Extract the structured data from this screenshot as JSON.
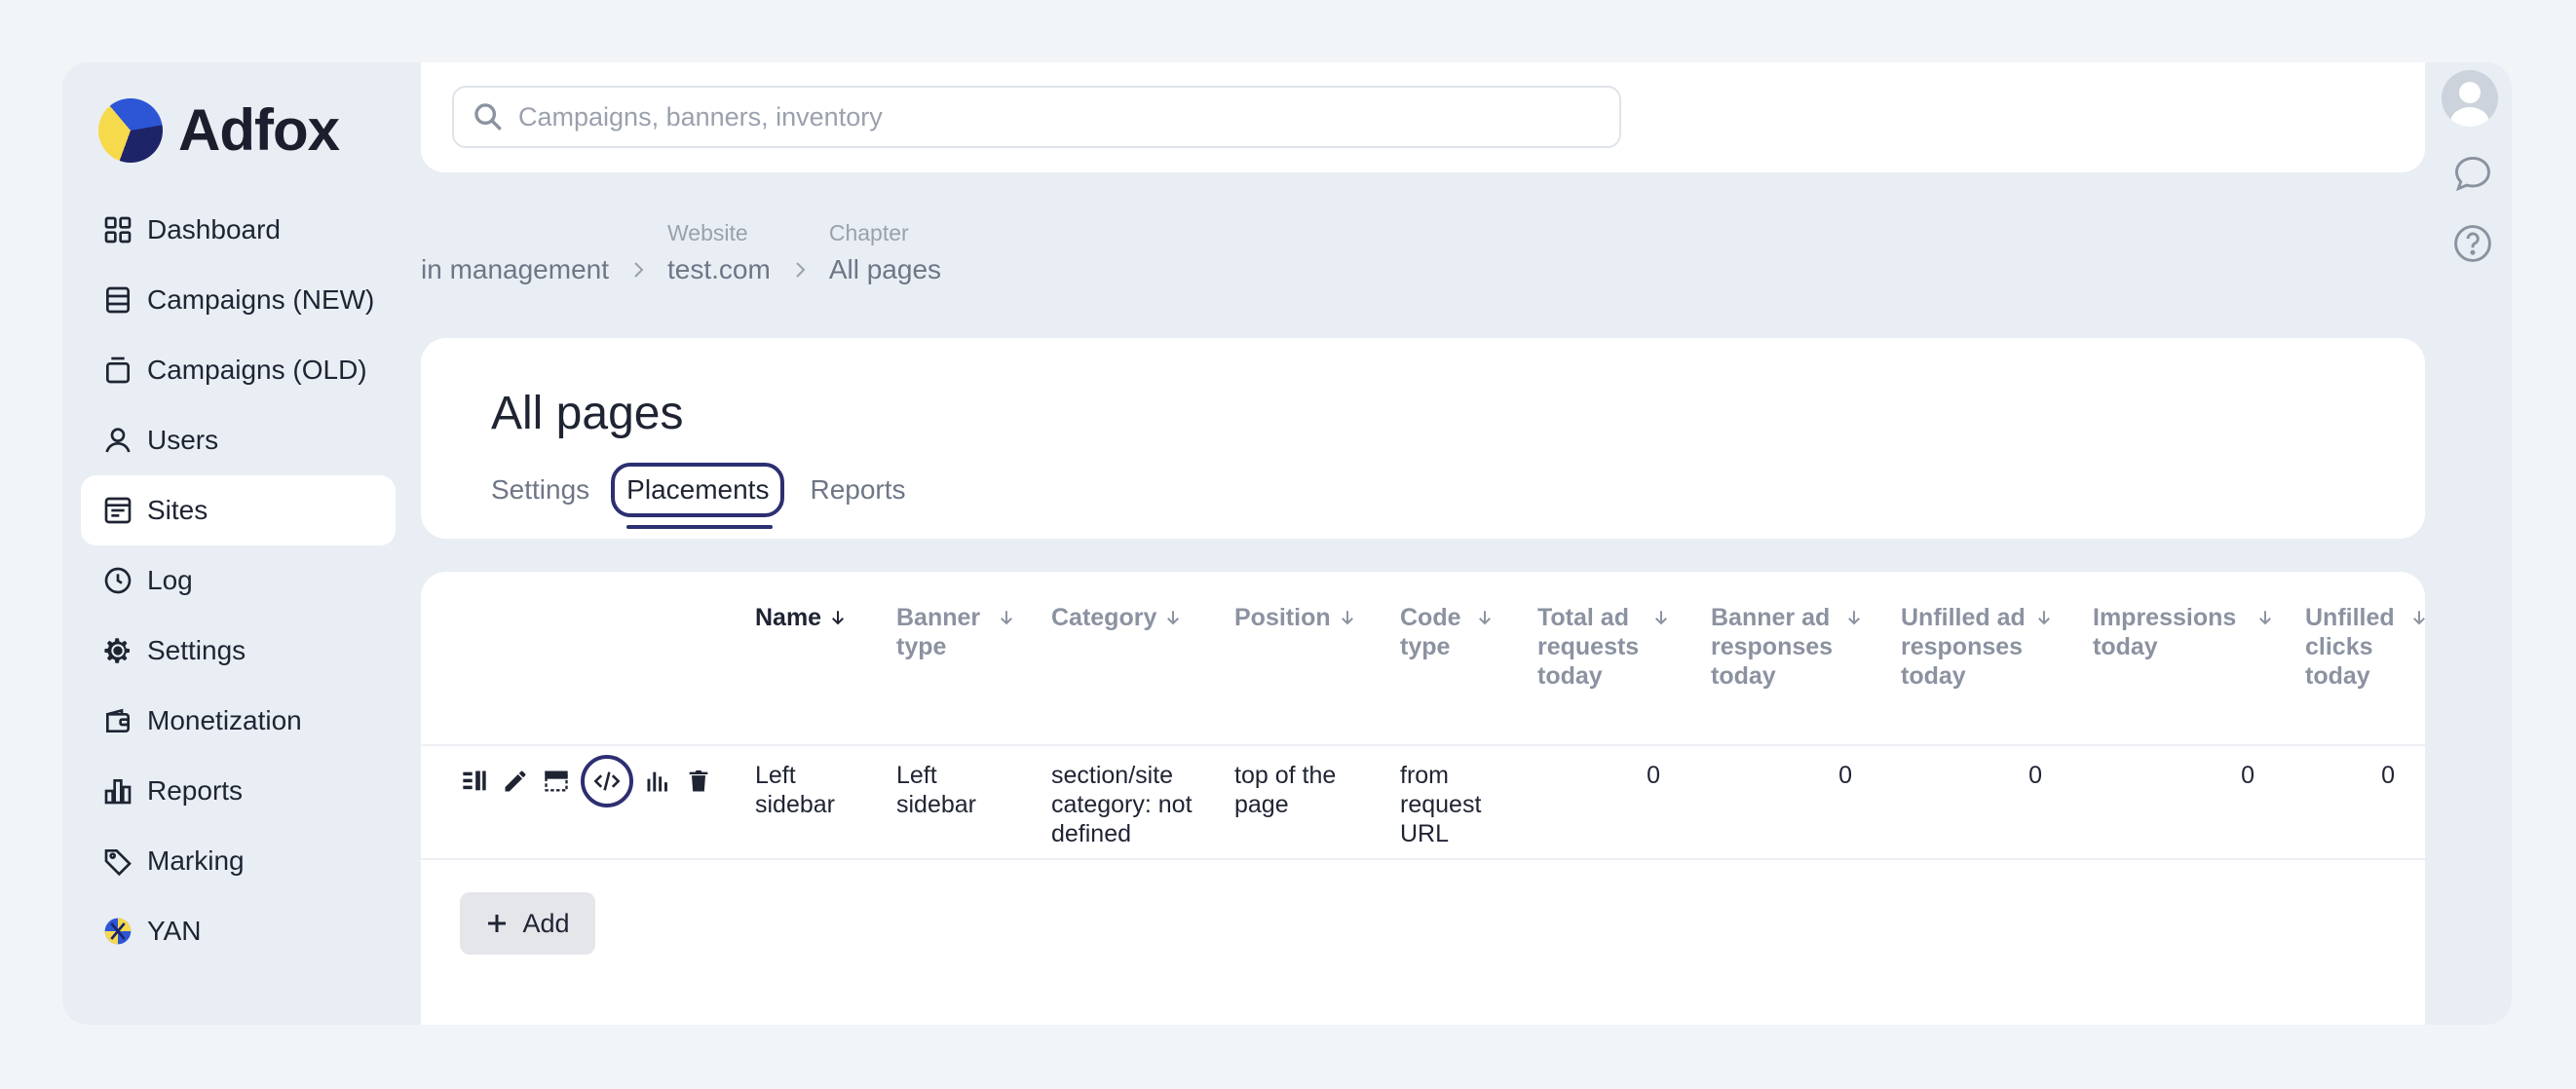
{
  "app": {
    "name": "Adfox"
  },
  "search": {
    "placeholder": "Campaigns, banners, inventory"
  },
  "sidebar": {
    "items": [
      {
        "label": "Dashboard",
        "icon": "dashboard-icon"
      },
      {
        "label": "Campaigns (NEW)",
        "icon": "campaigns-new-icon"
      },
      {
        "label": "Campaigns (OLD)",
        "icon": "campaigns-old-icon"
      },
      {
        "label": "Users",
        "icon": "user-icon"
      },
      {
        "label": "Sites",
        "icon": "sites-icon",
        "active": true
      },
      {
        "label": "Log",
        "icon": "clock-icon"
      },
      {
        "label": "Settings",
        "icon": "gear-icon"
      },
      {
        "label": "Monetization",
        "icon": "wallet-icon"
      },
      {
        "label": "Reports",
        "icon": "reports-icon"
      },
      {
        "label": "Marking",
        "icon": "tag-icon"
      },
      {
        "label": "YAN",
        "icon": "yan-icon"
      }
    ]
  },
  "breadcrumbs": [
    {
      "caption": "",
      "label": "in management"
    },
    {
      "caption": "Website",
      "label": "test.com"
    },
    {
      "caption": "Chapter",
      "label": "All pages"
    }
  ],
  "page": {
    "title": "All pages",
    "tabs": [
      {
        "label": "Settings"
      },
      {
        "label": "Placements",
        "active": true
      },
      {
        "label": "Reports"
      }
    ]
  },
  "table": {
    "columns": [
      {
        "label": "Name",
        "sorted": true
      },
      {
        "label": "Banner type"
      },
      {
        "label": "Category"
      },
      {
        "label": "Position"
      },
      {
        "label": "Code type"
      },
      {
        "label": "Total ad requests today"
      },
      {
        "label": "Banner ad responses today"
      },
      {
        "label": "Unfilled ad responses today"
      },
      {
        "label": "Impressions today"
      },
      {
        "label": "Unfilled clicks today"
      }
    ],
    "rows": [
      {
        "name": "Left sidebar",
        "banner_type": "Left sidebar",
        "category": "section/site category: not defined",
        "position": "top of the page",
        "code_type": "from request URL",
        "total_ad_requests_today": "0",
        "banner_ad_responses_today": "0",
        "unfilled_ad_responses_today": "0",
        "impressions_today": "0",
        "unfilled_clicks_today": "0"
      }
    ],
    "row_actions": [
      "list-icon",
      "pencil-icon",
      "layout-icon",
      "code-icon",
      "bar-chart-icon",
      "trash-icon"
    ]
  },
  "add_button": {
    "label": "Add"
  }
}
